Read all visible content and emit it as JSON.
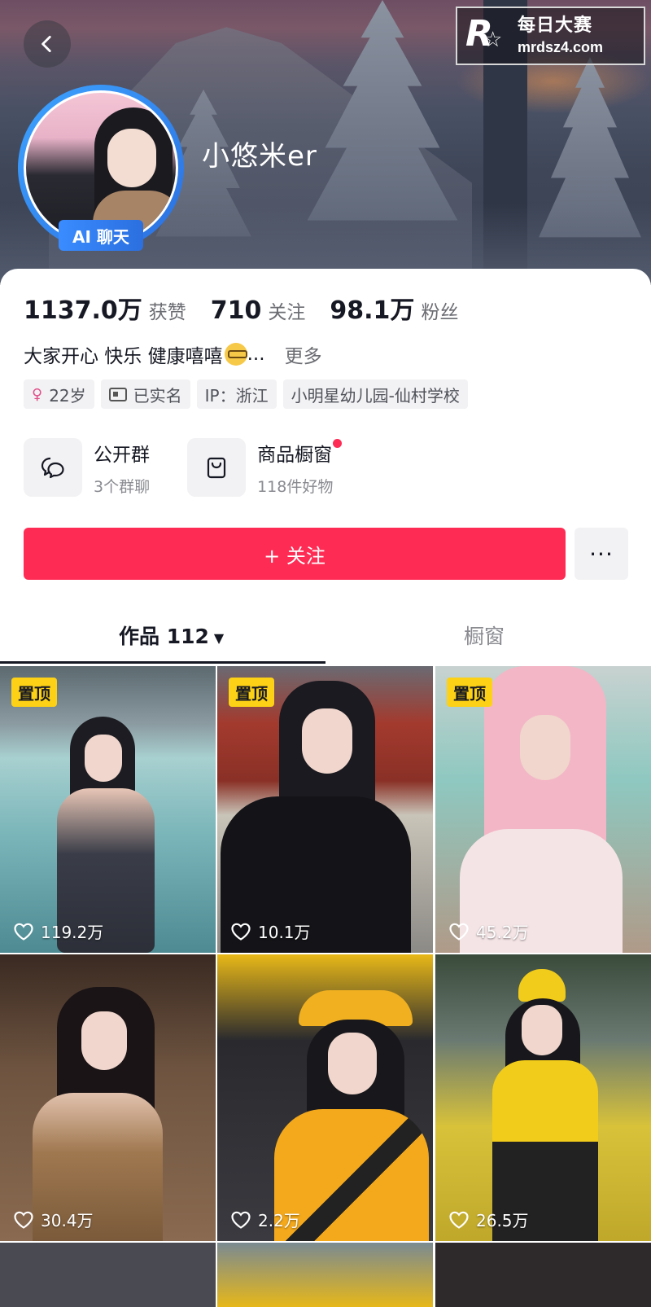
{
  "header": {
    "back_icon": "chevron-left-icon",
    "watermark": {
      "logo_letter": "R",
      "title": "每日大赛",
      "url": "mrdsz4.com"
    },
    "ai_badge": "AI 聊天",
    "nickname": "小悠米er"
  },
  "stats": [
    {
      "value": "1137.0万",
      "label": "获赞"
    },
    {
      "value": "710",
      "label": "关注"
    },
    {
      "value": "98.1万",
      "label": "粉丝"
    }
  ],
  "bio": {
    "text": "大家开心 快乐 健康嘻嘻",
    "ellipsis": "...",
    "more": "更多"
  },
  "tags": [
    {
      "icon": "female-icon",
      "text": "22岁"
    },
    {
      "icon": "id-card-icon",
      "text": "已实名"
    },
    {
      "icon": "",
      "text": "IP：浙江"
    },
    {
      "icon": "",
      "text": "小明星幼儿园-仙村学校"
    }
  ],
  "services": [
    {
      "icon": "chat-bubbles-icon",
      "title": "公开群",
      "subtitle": "3个群聊"
    },
    {
      "icon": "shopping-bag-icon",
      "title": "商品橱窗",
      "subtitle": "118件好物"
    }
  ],
  "actions": {
    "follow": "+ 关注",
    "more": "···"
  },
  "tabs": {
    "works_label": "作品 112",
    "shop_label": "橱窗"
  },
  "videos": [
    {
      "pinned": "置顶",
      "likes": "119.2万"
    },
    {
      "pinned": "置顶",
      "likes": "10.1万"
    },
    {
      "pinned": "置顶",
      "likes": "45.2万"
    },
    {
      "pinned": "",
      "likes": "30.4万"
    },
    {
      "pinned": "",
      "likes": "2.2万"
    },
    {
      "pinned": "",
      "likes": "26.5万"
    }
  ],
  "colors": {
    "accent": "#fe2c55",
    "pin": "#fcd116",
    "ai_badge": "#2b6fe0"
  }
}
